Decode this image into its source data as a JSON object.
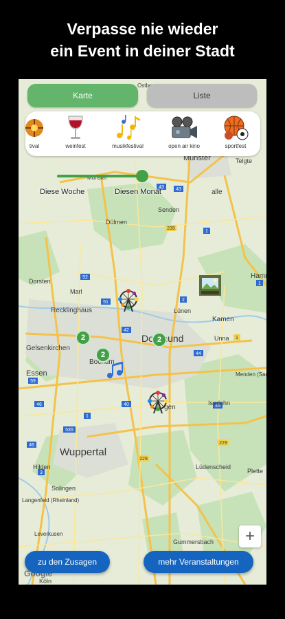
{
  "headline": {
    "line1": "Verpasse nie wieder",
    "line2": "ein Event in deiner Stadt"
  },
  "tabs": {
    "map": "Karte",
    "list": "Liste",
    "active": "Karte"
  },
  "categories": [
    {
      "label": "tival",
      "icon": "festival-icon"
    },
    {
      "label": "weinfest",
      "icon": "wine-glass-icon"
    },
    {
      "label": "musikfestival",
      "icon": "music-notes-icon"
    },
    {
      "label": "open air kino",
      "icon": "movie-camera-icon"
    },
    {
      "label": "sportfest",
      "icon": "sports-balls-icon"
    }
  ],
  "time_filter": {
    "left_label": "Diese Woche",
    "right_label": "Diesen Monat"
  },
  "map": {
    "cities": {
      "muenster": "Münster",
      "telgte": "Telgte",
      "ahlen": "alle",
      "senden": "Senden",
      "duelmen": "Dülmen",
      "hamm": "Hamm",
      "dorsten": "Dorsten",
      "marl": "Marl",
      "recklinghausen": "Recklinghaus",
      "luenen": "Lünen",
      "kamen": "Kamen",
      "unna": "Unna",
      "gelsenkirchen": "Gelsenkirchen",
      "dortmund": "Dortmund",
      "bochum": "Bochum",
      "essen": "Essen",
      "hagen": "gen",
      "menden": "Menden (Sauerland)",
      "iserlohn": "Iserlohn",
      "wuppertal": "Wuppertal",
      "luedenscheid": "Lüdenscheid",
      "plettenberg": "Plette",
      "hilden": "Hilden",
      "solingen": "Solingen",
      "langenfeld": "Langenfeld (Rheinland)",
      "leverkusen": "Leverkusen",
      "gummersbach": "Gummersbach",
      "koeln": "Köln",
      "stoeckel": "Ostbevern",
      "muenster_pre": "Münster"
    },
    "road_numbers": [
      "43",
      "235",
      "52",
      "51",
      "2",
      "1",
      "44",
      "42",
      "1",
      "535",
      "46",
      "3",
      "1",
      "40",
      "43",
      "45",
      "46",
      "229",
      "1",
      "59",
      "229"
    ],
    "clusters": [
      "2",
      "2",
      "2"
    ],
    "zoom_in": "+",
    "attribution": "Google"
  },
  "buttons": {
    "commitments": "zu den Zusagen",
    "more_events": "mehr Veranstaltungen"
  },
  "colors": {
    "accent_green": "#43a047",
    "tab_active": "#62b56b",
    "button_blue": "#1565c0"
  }
}
